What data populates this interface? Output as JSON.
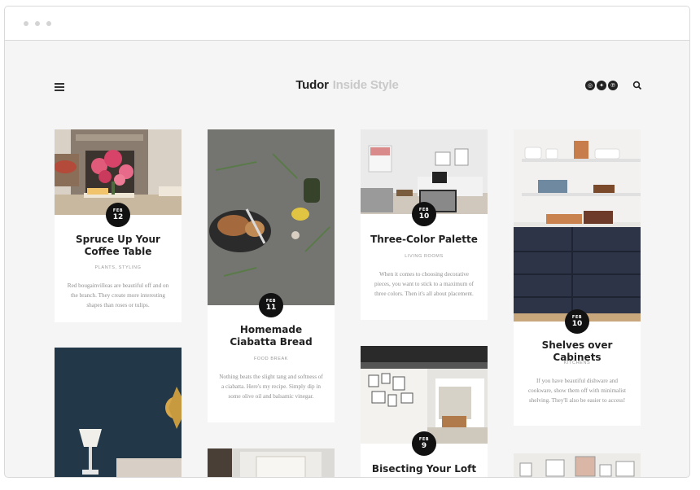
{
  "site": {
    "name_primary": "Tudor",
    "name_secondary": "Inside Style"
  },
  "header": {
    "menu_icon": "hamburger-icon",
    "social_icons": [
      "instagram-icon",
      "twitter-icon",
      "pinterest-icon"
    ],
    "search_icon": "search-icon"
  },
  "colors": {
    "badge": "#111111",
    "title": "#222222",
    "brand_secondary": "#c9c9c9",
    "background": "#f5f5f5"
  },
  "posts": [
    {
      "month": "FEB",
      "day": "12",
      "title": "Spruce Up Your Coffee Table",
      "category": "PLANTS, STYLING",
      "excerpt": "Red bougainvilleas are beautiful off and on the branch. They create more interesting shapes than roses or tulips."
    },
    {
      "month": "FEB",
      "day": "11",
      "title": "Homemade Ciabatta Bread",
      "category": "FOOD BREAK",
      "excerpt": "Nothing beats the slight tang and softness of a ciabatta. Here's my recipe. Simply dip in some olive oil and balsamic vinegar."
    },
    {
      "month": "FEB",
      "day": "10",
      "title": "Three-Color Palette",
      "category": "LIVING ROOMS",
      "excerpt": "When it comes to choosing decorative pieces, you want to stick to a maximum of three colors. Then it's all about placement."
    },
    {
      "month": "FEB",
      "day": "10",
      "title": "Shelves over Cabinets",
      "category": "KITCHENS",
      "excerpt": "If you have beautiful dishware and cookware, show them off with minimalist shelving. They'll also be easier to access!"
    },
    {
      "month": "FEB",
      "day": "9",
      "title": "Bisecting Your Loft",
      "category": "",
      "excerpt": ""
    }
  ]
}
